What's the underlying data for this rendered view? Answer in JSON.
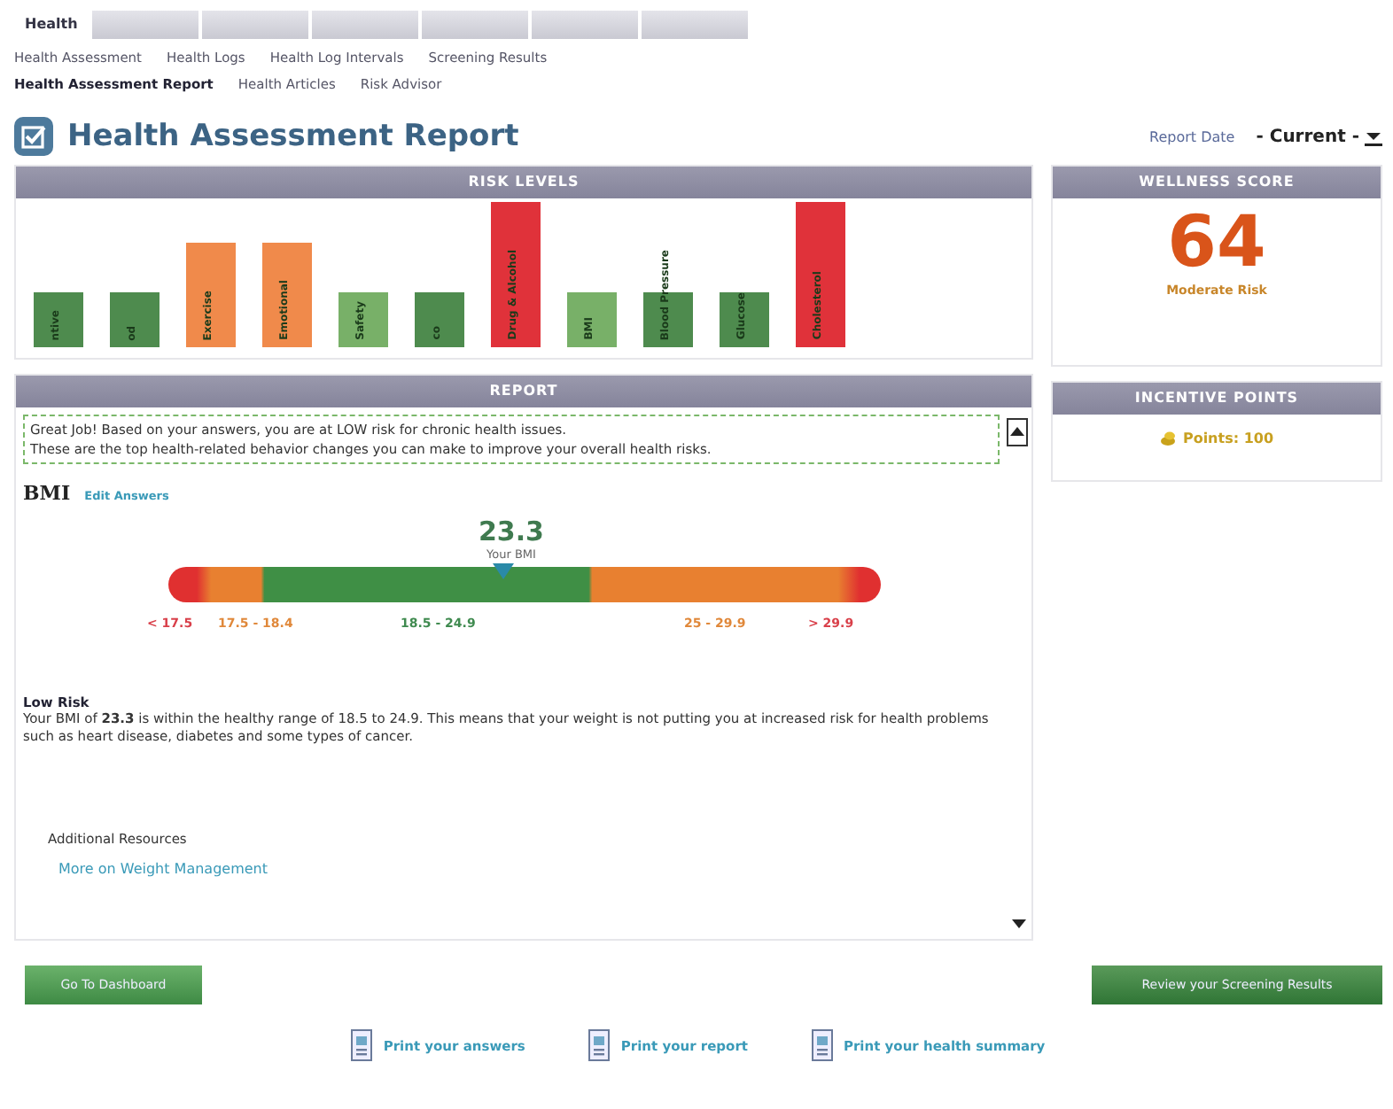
{
  "top_tabs": [
    {
      "label": "Health",
      "selected": true
    },
    {
      "selected": false
    },
    {
      "selected": false
    },
    {
      "selected": false
    },
    {
      "selected": false
    },
    {
      "selected": false
    },
    {
      "selected": false
    }
  ],
  "subnav_rows": [
    [
      {
        "label": "Health Assessment",
        "selected": false
      },
      {
        "label": "Health Logs",
        "selected": false
      },
      {
        "label": "Health Log Intervals",
        "selected": false
      },
      {
        "label": "Screening Results",
        "selected": false
      }
    ],
    [
      {
        "label": "Health Assessment Report",
        "selected": true
      },
      {
        "label": "Health Articles",
        "selected": false
      },
      {
        "label": "Risk Advisor",
        "selected": false
      }
    ]
  ],
  "page_title": "Health Assessment Report",
  "report_date": {
    "label": "Report Date",
    "value": "- Current -"
  },
  "risk_levels": {
    "header": "RISK LEVELS",
    "bars": [
      {
        "label": "ntive",
        "kind": "short",
        "color": "#4e8b4e"
      },
      {
        "label": "od",
        "kind": "short",
        "color": "#4e8b4e"
      },
      {
        "label": "Exercise",
        "kind": "medium",
        "color": "#f08a4b"
      },
      {
        "label": "Emotional",
        "kind": "medium",
        "color": "#f08a4b"
      },
      {
        "label": "Safety",
        "kind": "short",
        "color": "#78b068"
      },
      {
        "label": "co",
        "kind": "short",
        "color": "#4e8b4e"
      },
      {
        "label": "Drug & Alcohol",
        "kind": "tall",
        "color": "#e0323a"
      },
      {
        "label": "BMI",
        "kind": "short",
        "color": "#78b068"
      },
      {
        "label": "Blood Pressure",
        "kind": "short",
        "color": "#4e8b4e"
      },
      {
        "label": "Glucose",
        "kind": "short",
        "color": "#4e8b4e"
      },
      {
        "label": "Cholesterol",
        "kind": "tall",
        "color": "#e0323a"
      }
    ]
  },
  "wellness_score": {
    "header": "WELLNESS SCORE",
    "score": "64",
    "rating": "Moderate Risk"
  },
  "incentive_points": {
    "header": "INCENTIVE POINTS",
    "text": "Points: 100"
  },
  "report": {
    "header": "REPORT",
    "summary": [
      "Great Job! Based on your answers, you are at LOW risk for chronic health issues.",
      "These are the top health-related behavior changes you can make to improve your overall health risks."
    ],
    "metric": "BMI",
    "edit_link": "Edit Answers",
    "value": "23.3",
    "value_caption": "Your BMI",
    "level": 0.47,
    "ranges": [
      {
        "label": "< 17.5",
        "color": "#d9404a"
      },
      {
        "label": "17.5 - 18.4",
        "color": "#e0883a"
      },
      {
        "label": "18.5 - 24.9",
        "color": "#3f8a4f"
      },
      {
        "label": "25 - 29.9",
        "color": "#e0883a"
      },
      {
        "label": "> 29.9",
        "color": "#d9404a"
      }
    ],
    "risk_title": "Low Risk",
    "risk_text": "Your BMI of **23.3** is within the healthy range of 18.5 to 24.9. This means that your weight is not putting you at increased risk for health problems such as heart disease, diabetes and some types of cancer.",
    "resources_title": "Additional Resources",
    "resource_link": "More on Weight Management"
  },
  "buttons": {
    "left": "Go To Dashboard",
    "right": "Review your Screening Results"
  },
  "print_links": [
    "Print your answers",
    "Print your report",
    "Print your health summary"
  ]
}
